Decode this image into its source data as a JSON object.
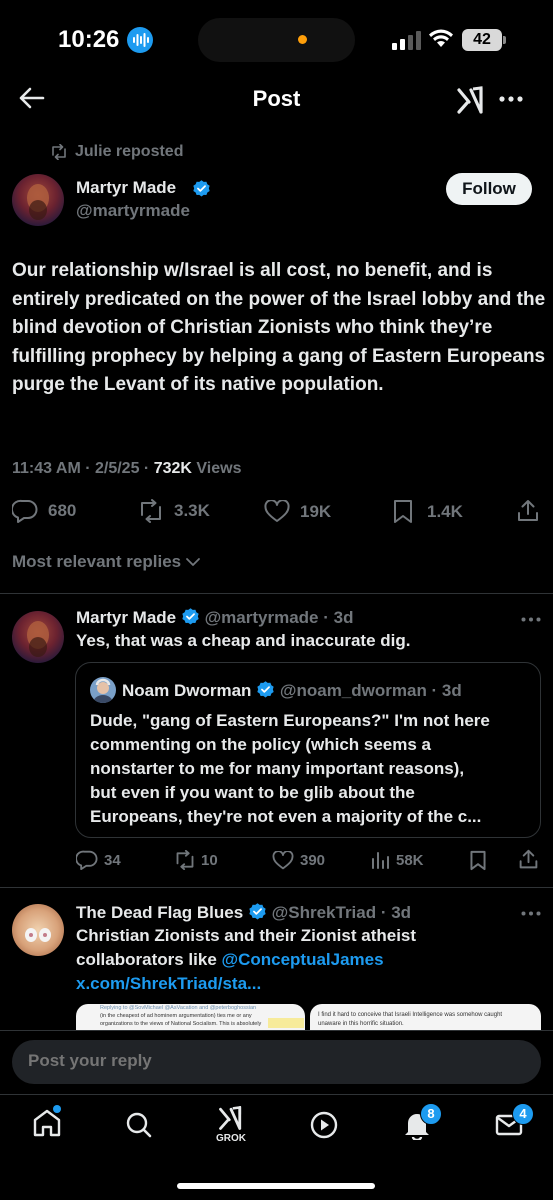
{
  "status_bar": {
    "time": "10:26",
    "battery": "42"
  },
  "header": {
    "title": "Post"
  },
  "main_post": {
    "repost_label": "Julie reposted",
    "author_name": "Martyr Made",
    "author_handle": "@martyrmade",
    "follow_label": "Follow",
    "text": "Our relationship w/Israel is all cost, no benefit, and is entirely predicated on the power of the Israel lobby and the blind devotion of Christian Zionists who think they’re fulfilling prophecy by helping a gang of Eastern Europeans purge the Levant of its native population.",
    "timestamp": "11:43 AM · 2/5/25 · ",
    "views_count": "732K",
    "views_label": " Views",
    "stats": {
      "replies": "680",
      "reposts": "3.3K",
      "likes": "19K",
      "bookmarks": "1.4K"
    }
  },
  "replies_filter": {
    "label": "Most relevant replies"
  },
  "reply1": {
    "author_name": "Martyr Made",
    "meta": "@martyrmade · 3d",
    "text": "Yes, that was a cheap and inaccurate dig.",
    "quote": {
      "author_name": "Noam Dworman",
      "meta": "@noam_dworman · 3d",
      "text": "Dude, \"gang of Eastern Europeans?\"  I'm not here\ncommenting on the policy (which seems a\nnonstarter to me for many important reasons),\nbut even if you want to be glib about the\nEuropeans, they're not even a majority of the c..."
    },
    "stats": {
      "replies": "34",
      "reposts": "10",
      "likes": "390",
      "views": "58K"
    }
  },
  "reply2": {
    "author_name": "The Dead Flag Blues",
    "meta": "@ShrekTriad · 3d",
    "text_line1": "Christian Zionists and their Zionist atheist",
    "text_line2_prefix": "collaborators like ",
    "mention": "@ConceptualJames",
    "link": "x.com/ShrekTriad/sta...",
    "image1_line1": "Replying to @SovMichael @AsVacation and @peterboghossian",
    "image1_line2": "(in the cheapest of ad hominem argumentation) ties me or any",
    "image1_line3": "organizations to the views of National Socialism.  This is absolutely",
    "image2_line1": "I find it hard to conceive that Israeli Intelligence was somehow caught",
    "image2_line2": "unaware in this horrific situation."
  },
  "compose": {
    "placeholder": "Post your reply"
  },
  "tab_bar": {
    "grok_label": "GROK",
    "notifications_badge": "8",
    "messages_badge": "4"
  },
  "colors": {
    "accent": "#1d9bf0",
    "background": "#000000",
    "muted": "#71767b"
  }
}
